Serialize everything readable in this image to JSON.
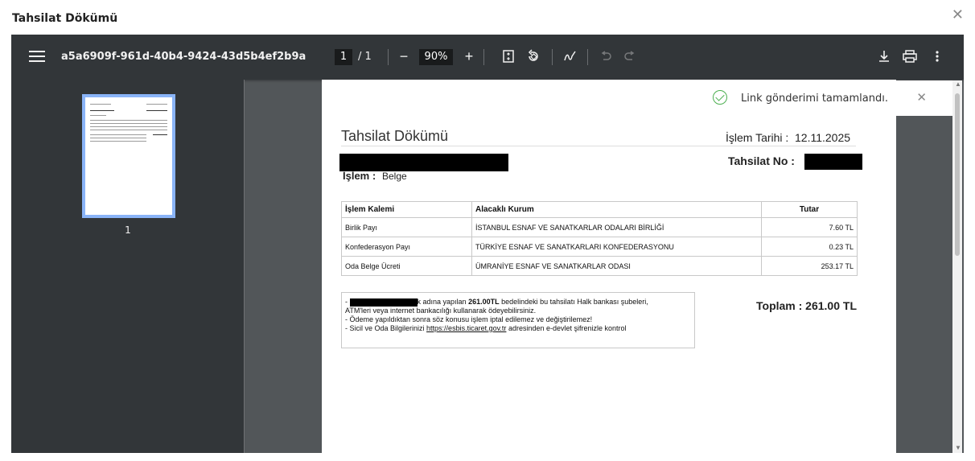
{
  "dialog": {
    "title": "Tahsilat Dökümü",
    "close": "✕"
  },
  "toolbar": {
    "filename": "a5a6909f-961d-40b4-9424-43d5b4ef2b9a",
    "page_current": "1",
    "page_total": "/ 1",
    "zoom": "90%",
    "zoom_out": "−",
    "zoom_in": "+"
  },
  "sidebar": {
    "thumbnail_label": "1"
  },
  "toast": {
    "message": "Link gönderimi tamamlandı.",
    "close": "✕"
  },
  "document": {
    "title": "Tahsilat Dökümü",
    "date_label": "İşlem Tarihi :",
    "date_value": "12.11.2025",
    "tahsilat_no_label": "Tahsilat No :",
    "islem_label": "İşlem :",
    "islem_value": "Belge",
    "table": {
      "headers": [
        "İşlem Kalemi",
        "Alacaklı Kurum",
        "Tutar"
      ],
      "rows": [
        [
          "Birlik Payı",
          "İSTANBUL ESNAF VE SANATKARLAR ODALARI BİRLİĞİ",
          "7.60 TL"
        ],
        [
          "Konfederasyon Payı",
          "TÜRKİYE ESNAF VE SANATKARLARI KONFEDERASYONU",
          "0.23 TL"
        ],
        [
          "Oda Belge Ücreti",
          "ÜMRANİYE ESNAF VE SANATKARLAR ODASI",
          "253.17 TL"
        ]
      ]
    },
    "notes": {
      "line1_dash": "-",
      "line1_suffix": "k adına yapılan",
      "line1_amount": "261.00TL",
      "line1_rest": "bedelindeki bu tahsilatı Halk bankası şubeleri,",
      "line2": "ATM'leri veya internet bankacılığı kullanarak ödeyebilirsiniz.",
      "line3": "- Ödeme yapıldıktan sonra söz konusu işlem iptal edilemez ve değiştirilemez!",
      "line4_prefix": "- Sicil ve Oda Bilgilerinizi",
      "line4_link": "https://esbis.ticaret.gov.tr",
      "line4_suffix": "adresinden e-devlet şifrenizle kontrol"
    },
    "total": "Toplam : 261.00 TL"
  },
  "colors": {
    "toolbar_bg": "#323639",
    "viewer_bg": "#525659",
    "thumb_border": "#8ab4f8",
    "success": "#4caf50"
  },
  "icons": {
    "menu": "hamburger-menu-icon",
    "fit": "fit-to-page-icon",
    "rotate": "rotate-icon",
    "annotate": "annotate-pen-icon",
    "undo": "undo-icon",
    "redo": "redo-icon",
    "download": "download-icon",
    "print": "print-icon",
    "more": "more-vert-icon"
  }
}
